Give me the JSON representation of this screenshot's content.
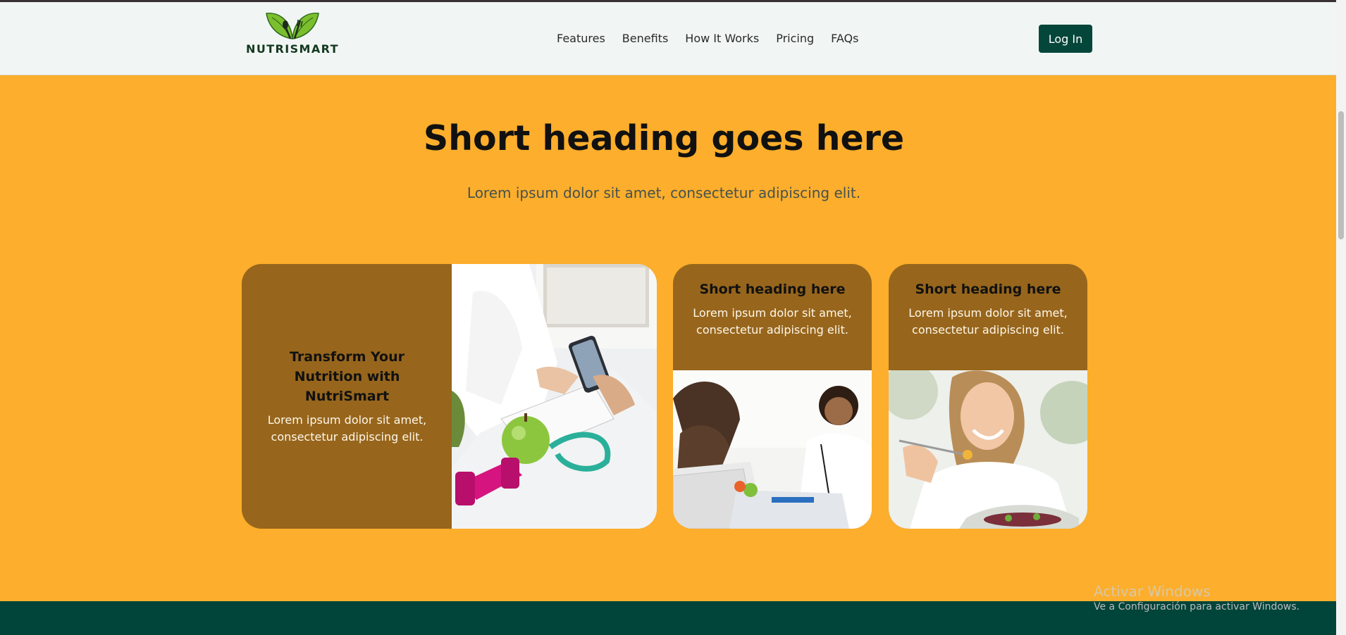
{
  "brand": {
    "name": "NUTRISMART",
    "accent": "#04463a",
    "hero_bg": "#fcae2c",
    "card_bg": "#97661c"
  },
  "nav": {
    "items": [
      "Features",
      "Benefits",
      "How It Works",
      "Pricing",
      "FAQs"
    ],
    "login_label": "Log In"
  },
  "hero": {
    "heading": "Short heading goes here",
    "subheading": "Lorem ipsum dolor sit amet, consectetur adipiscing elit."
  },
  "cards": [
    {
      "title": "Transform Your Nutrition with NutriSmart",
      "text": "Lorem ipsum dolor sit amet, consectetur adipiscing elit.",
      "image": "nutritionist-with-apple-and-dumbbells"
    },
    {
      "title": "Short heading here",
      "text": "Lorem ipsum dolor sit amet, consectetur adipiscing elit.",
      "image": "doctor-consultation"
    },
    {
      "title": "Short heading here",
      "text": "Lorem ipsum dolor sit amet, consectetur adipiscing elit.",
      "image": "woman-eating-salad"
    }
  ],
  "watermark": {
    "title": "Activar Windows",
    "subtitle": "Ve a Configuración para activar Windows."
  }
}
